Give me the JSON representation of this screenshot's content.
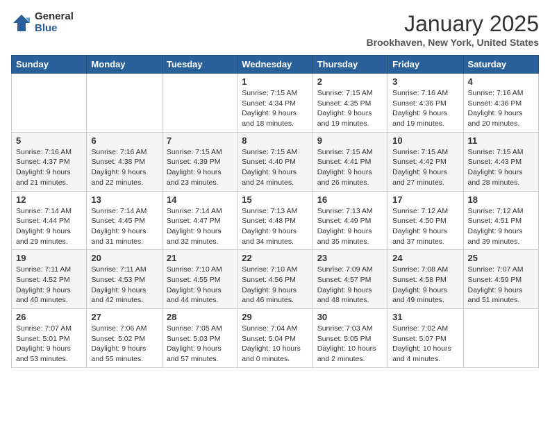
{
  "header": {
    "logo_general": "General",
    "logo_blue": "Blue",
    "month_title": "January 2025",
    "location": "Brookhaven, New York, United States"
  },
  "days_of_week": [
    "Sunday",
    "Monday",
    "Tuesday",
    "Wednesday",
    "Thursday",
    "Friday",
    "Saturday"
  ],
  "weeks": [
    [
      {
        "day": "",
        "info": ""
      },
      {
        "day": "",
        "info": ""
      },
      {
        "day": "",
        "info": ""
      },
      {
        "day": "1",
        "info": "Sunrise: 7:15 AM\nSunset: 4:34 PM\nDaylight: 9 hours\nand 18 minutes."
      },
      {
        "day": "2",
        "info": "Sunrise: 7:15 AM\nSunset: 4:35 PM\nDaylight: 9 hours\nand 19 minutes."
      },
      {
        "day": "3",
        "info": "Sunrise: 7:16 AM\nSunset: 4:36 PM\nDaylight: 9 hours\nand 19 minutes."
      },
      {
        "day": "4",
        "info": "Sunrise: 7:16 AM\nSunset: 4:36 PM\nDaylight: 9 hours\nand 20 minutes."
      }
    ],
    [
      {
        "day": "5",
        "info": "Sunrise: 7:16 AM\nSunset: 4:37 PM\nDaylight: 9 hours\nand 21 minutes."
      },
      {
        "day": "6",
        "info": "Sunrise: 7:16 AM\nSunset: 4:38 PM\nDaylight: 9 hours\nand 22 minutes."
      },
      {
        "day": "7",
        "info": "Sunrise: 7:15 AM\nSunset: 4:39 PM\nDaylight: 9 hours\nand 23 minutes."
      },
      {
        "day": "8",
        "info": "Sunrise: 7:15 AM\nSunset: 4:40 PM\nDaylight: 9 hours\nand 24 minutes."
      },
      {
        "day": "9",
        "info": "Sunrise: 7:15 AM\nSunset: 4:41 PM\nDaylight: 9 hours\nand 26 minutes."
      },
      {
        "day": "10",
        "info": "Sunrise: 7:15 AM\nSunset: 4:42 PM\nDaylight: 9 hours\nand 27 minutes."
      },
      {
        "day": "11",
        "info": "Sunrise: 7:15 AM\nSunset: 4:43 PM\nDaylight: 9 hours\nand 28 minutes."
      }
    ],
    [
      {
        "day": "12",
        "info": "Sunrise: 7:14 AM\nSunset: 4:44 PM\nDaylight: 9 hours\nand 29 minutes."
      },
      {
        "day": "13",
        "info": "Sunrise: 7:14 AM\nSunset: 4:45 PM\nDaylight: 9 hours\nand 31 minutes."
      },
      {
        "day": "14",
        "info": "Sunrise: 7:14 AM\nSunset: 4:47 PM\nDaylight: 9 hours\nand 32 minutes."
      },
      {
        "day": "15",
        "info": "Sunrise: 7:13 AM\nSunset: 4:48 PM\nDaylight: 9 hours\nand 34 minutes."
      },
      {
        "day": "16",
        "info": "Sunrise: 7:13 AM\nSunset: 4:49 PM\nDaylight: 9 hours\nand 35 minutes."
      },
      {
        "day": "17",
        "info": "Sunrise: 7:12 AM\nSunset: 4:50 PM\nDaylight: 9 hours\nand 37 minutes."
      },
      {
        "day": "18",
        "info": "Sunrise: 7:12 AM\nSunset: 4:51 PM\nDaylight: 9 hours\nand 39 minutes."
      }
    ],
    [
      {
        "day": "19",
        "info": "Sunrise: 7:11 AM\nSunset: 4:52 PM\nDaylight: 9 hours\nand 40 minutes."
      },
      {
        "day": "20",
        "info": "Sunrise: 7:11 AM\nSunset: 4:53 PM\nDaylight: 9 hours\nand 42 minutes."
      },
      {
        "day": "21",
        "info": "Sunrise: 7:10 AM\nSunset: 4:55 PM\nDaylight: 9 hours\nand 44 minutes."
      },
      {
        "day": "22",
        "info": "Sunrise: 7:10 AM\nSunset: 4:56 PM\nDaylight: 9 hours\nand 46 minutes."
      },
      {
        "day": "23",
        "info": "Sunrise: 7:09 AM\nSunset: 4:57 PM\nDaylight: 9 hours\nand 48 minutes."
      },
      {
        "day": "24",
        "info": "Sunrise: 7:08 AM\nSunset: 4:58 PM\nDaylight: 9 hours\nand 49 minutes."
      },
      {
        "day": "25",
        "info": "Sunrise: 7:07 AM\nSunset: 4:59 PM\nDaylight: 9 hours\nand 51 minutes."
      }
    ],
    [
      {
        "day": "26",
        "info": "Sunrise: 7:07 AM\nSunset: 5:01 PM\nDaylight: 9 hours\nand 53 minutes."
      },
      {
        "day": "27",
        "info": "Sunrise: 7:06 AM\nSunset: 5:02 PM\nDaylight: 9 hours\nand 55 minutes."
      },
      {
        "day": "28",
        "info": "Sunrise: 7:05 AM\nSunset: 5:03 PM\nDaylight: 9 hours\nand 57 minutes."
      },
      {
        "day": "29",
        "info": "Sunrise: 7:04 AM\nSunset: 5:04 PM\nDaylight: 10 hours\nand 0 minutes."
      },
      {
        "day": "30",
        "info": "Sunrise: 7:03 AM\nSunset: 5:05 PM\nDaylight: 10 hours\nand 2 minutes."
      },
      {
        "day": "31",
        "info": "Sunrise: 7:02 AM\nSunset: 5:07 PM\nDaylight: 10 hours\nand 4 minutes."
      },
      {
        "day": "",
        "info": ""
      }
    ]
  ]
}
